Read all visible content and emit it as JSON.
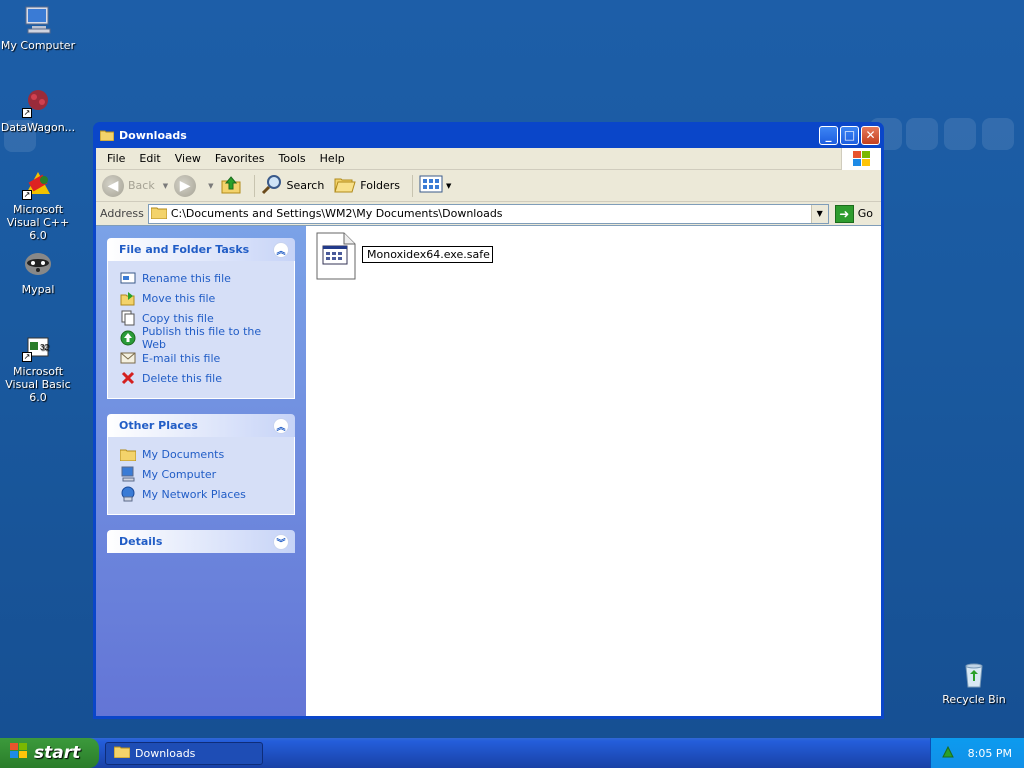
{
  "desktop": {
    "icons": [
      {
        "label": "My Computer",
        "icon": "computer-icon"
      },
      {
        "label": "DataWagon...",
        "icon": "datawagon-icon"
      },
      {
        "label": "Microsoft Visual C++ 6.0",
        "icon": "visual-cpp-icon"
      },
      {
        "label": "Mypal",
        "icon": "mypal-icon"
      },
      {
        "label": "Microsoft Visual Basic 6.0",
        "icon": "visual-basic-icon"
      },
      {
        "label": "Recycle Bin",
        "icon": "recycle-bin-icon"
      }
    ]
  },
  "window": {
    "title": "Downloads",
    "menu": [
      "File",
      "Edit",
      "View",
      "Favorites",
      "Tools",
      "Help"
    ],
    "toolbar": {
      "back": "Back",
      "search": "Search",
      "folders": "Folders"
    },
    "address": {
      "label": "Address",
      "value": "C:\\Documents and Settings\\WM2\\My Documents\\Downloads",
      "go": "Go"
    },
    "tasks": {
      "file_folder": {
        "title": "File and Folder Tasks",
        "items": [
          {
            "label": "Rename this file",
            "icon": "rename-icon"
          },
          {
            "label": "Move this file",
            "icon": "move-icon"
          },
          {
            "label": "Copy this file",
            "icon": "copy-icon"
          },
          {
            "label": "Publish this file to the Web",
            "icon": "publish-icon"
          },
          {
            "label": "E-mail this file",
            "icon": "email-icon"
          },
          {
            "label": "Delete this file",
            "icon": "delete-icon"
          }
        ]
      },
      "other_places": {
        "title": "Other Places",
        "items": [
          {
            "label": "My Documents",
            "icon": "folder-icon"
          },
          {
            "label": "My Computer",
            "icon": "computer-icon"
          },
          {
            "label": "My Network Places",
            "icon": "network-icon"
          }
        ]
      },
      "details": {
        "title": "Details"
      }
    },
    "files": [
      {
        "name": "Monoxidex64.exe.safe",
        "icon": "file-icon",
        "renaming": true
      }
    ]
  },
  "taskbar": {
    "start": "start",
    "task": "Downloads",
    "clock": "8:05 PM"
  },
  "colors": {
    "titlebar": "#0a46c9",
    "task_pane": "#6375d6",
    "link": "#215dc6"
  }
}
